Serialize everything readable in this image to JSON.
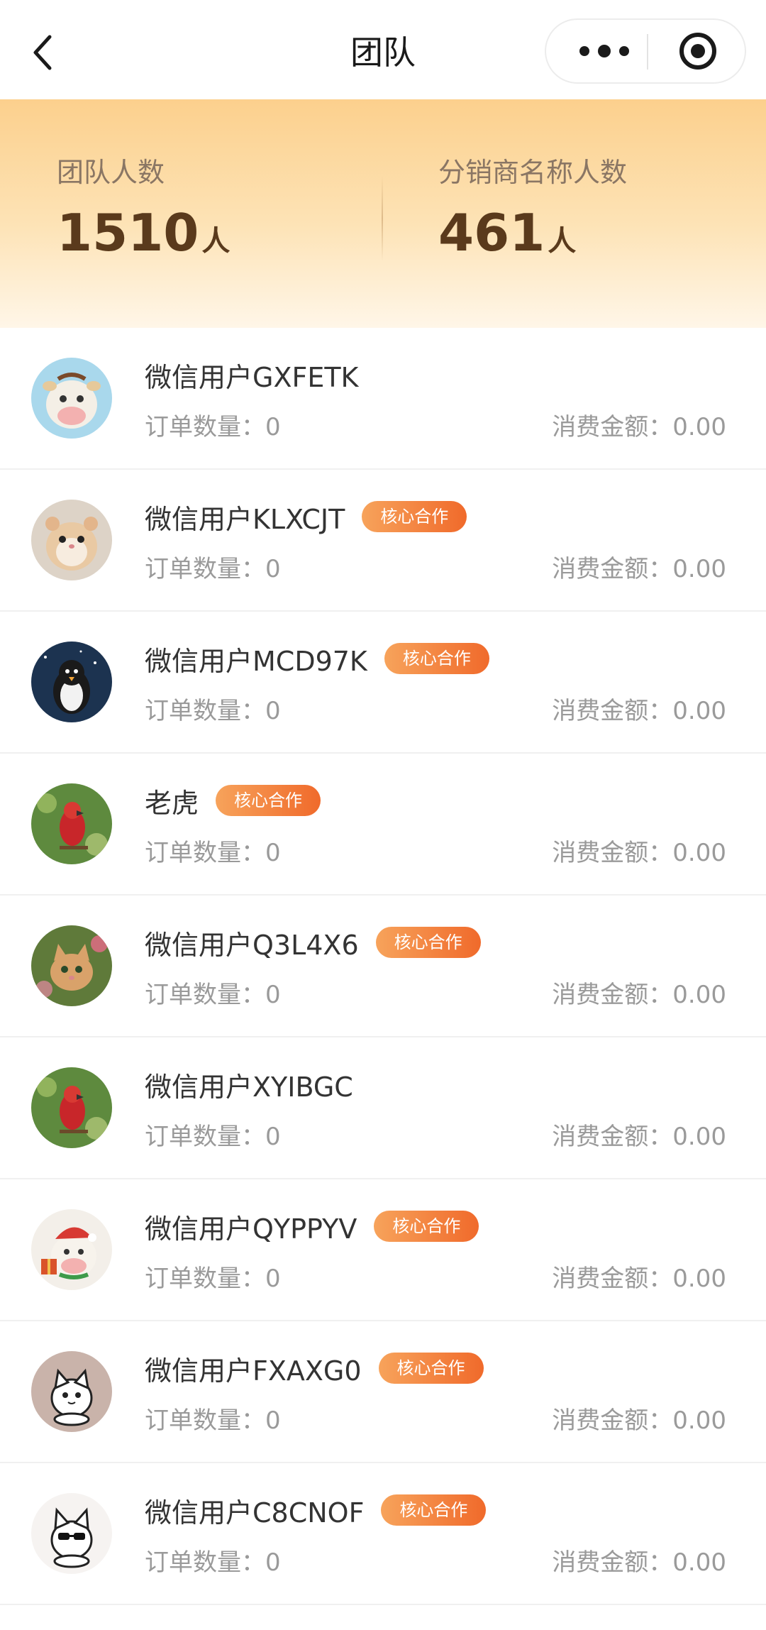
{
  "nav": {
    "title": "团队",
    "back_icon": "chevron-left-icon",
    "more_icon": "more-dots-icon",
    "close_icon": "target-circle-icon"
  },
  "stats": {
    "team_label": "团队人数",
    "team_value": "1510",
    "team_unit": "人",
    "dist_label": "分销商名称人数",
    "dist_value": "461",
    "dist_unit": "人"
  },
  "list_labels": {
    "orders_prefix": "订单数量：",
    "amount_prefix": "消费金额："
  },
  "members": [
    {
      "name": "微信用户GXFETK",
      "badge": "",
      "orders": "0",
      "amount": "0.00",
      "avatar": "cow-avatar"
    },
    {
      "name": "微信用户KLXCJT",
      "badge": "核心合作",
      "orders": "0",
      "amount": "0.00",
      "avatar": "hamster-avatar"
    },
    {
      "name": "微信用户MCD97K",
      "badge": "核心合作",
      "orders": "0",
      "amount": "0.00",
      "avatar": "penguin-avatar"
    },
    {
      "name": "老虎",
      "badge": "核心合作",
      "orders": "0",
      "amount": "0.00",
      "avatar": "parrot-avatar"
    },
    {
      "name": "微信用户Q3L4X6",
      "badge": "核心合作",
      "orders": "0",
      "amount": "0.00",
      "avatar": "kitten-avatar"
    },
    {
      "name": "微信用户XYIBGC",
      "badge": "",
      "orders": "0",
      "amount": "0.00",
      "avatar": "parrot-avatar"
    },
    {
      "name": "微信用户QYPPYV",
      "badge": "核心合作",
      "orders": "0",
      "amount": "0.00",
      "avatar": "christmas-cow-avatar"
    },
    {
      "name": "微信用户FXAXG0",
      "badge": "核心合作",
      "orders": "0",
      "amount": "0.00",
      "avatar": "cartoon-cat-avatar"
    },
    {
      "name": "微信用户C8CNOF",
      "badge": "核心合作",
      "orders": "0",
      "amount": "0.00",
      "avatar": "sunglasses-cat-avatar"
    }
  ],
  "colors": {
    "banner_top": "#fcd08d",
    "value_text": "#5a3a1c",
    "badge_start": "#f7a35b",
    "badge_end": "#f06a2b"
  }
}
